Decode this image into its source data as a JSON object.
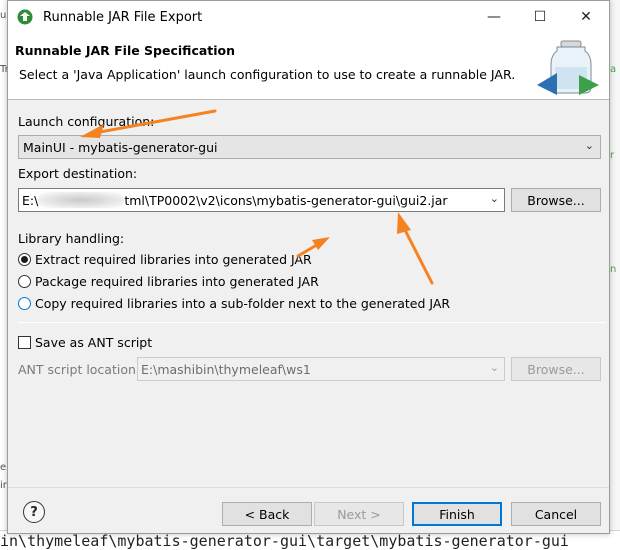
{
  "background": {
    "left_fragments": [
      "u",
      "Tr",
      "e",
      "ir"
    ],
    "right_fragments": [
      "a",
      "r",
      "n"
    ],
    "console_line": "in\\thymeleaf\\mybatis-generator-gui\\target\\mybatis-generator-gui"
  },
  "window": {
    "title": "Runnable JAR File Export",
    "minimize_glyph": "—",
    "maximize_glyph": "☐",
    "close_glyph": "✕"
  },
  "header": {
    "title": "Runnable JAR File Specification",
    "description": "Select a 'Java Application' launch configuration to use to create a runnable JAR."
  },
  "launch": {
    "label": "Launch configuration:",
    "value": "MainUI - mybatis-generator-gui"
  },
  "export": {
    "label": "Export destination:",
    "value_prefix": "E:\\",
    "value_suffix": "tml\\TP0002\\v2\\icons\\mybatis-generator-gui\\gui2.jar",
    "browse": "Browse..."
  },
  "library": {
    "label": "Library handling:",
    "options": [
      "Extract required libraries into generated JAR",
      "Package required libraries into generated JAR",
      "Copy required libraries into a sub-folder next to the generated JAR"
    ],
    "selected_index": 0
  },
  "ant": {
    "checkbox_label": "Save as ANT script",
    "checked": false,
    "location_label": "ANT script location:",
    "location_value": "E:\\mashibin\\thymeleaf\\ws1",
    "browse": "Browse..."
  },
  "buttons": {
    "help": "?",
    "back": "< Back",
    "next": "Next >",
    "finish": "Finish",
    "cancel": "Cancel"
  },
  "colors": {
    "accent": "#0078d7",
    "annotation_arrow": "#f58220"
  },
  "icons": {
    "app": "eclipse-export-icon",
    "wizard_banner": "jar-export-banner-icon"
  }
}
